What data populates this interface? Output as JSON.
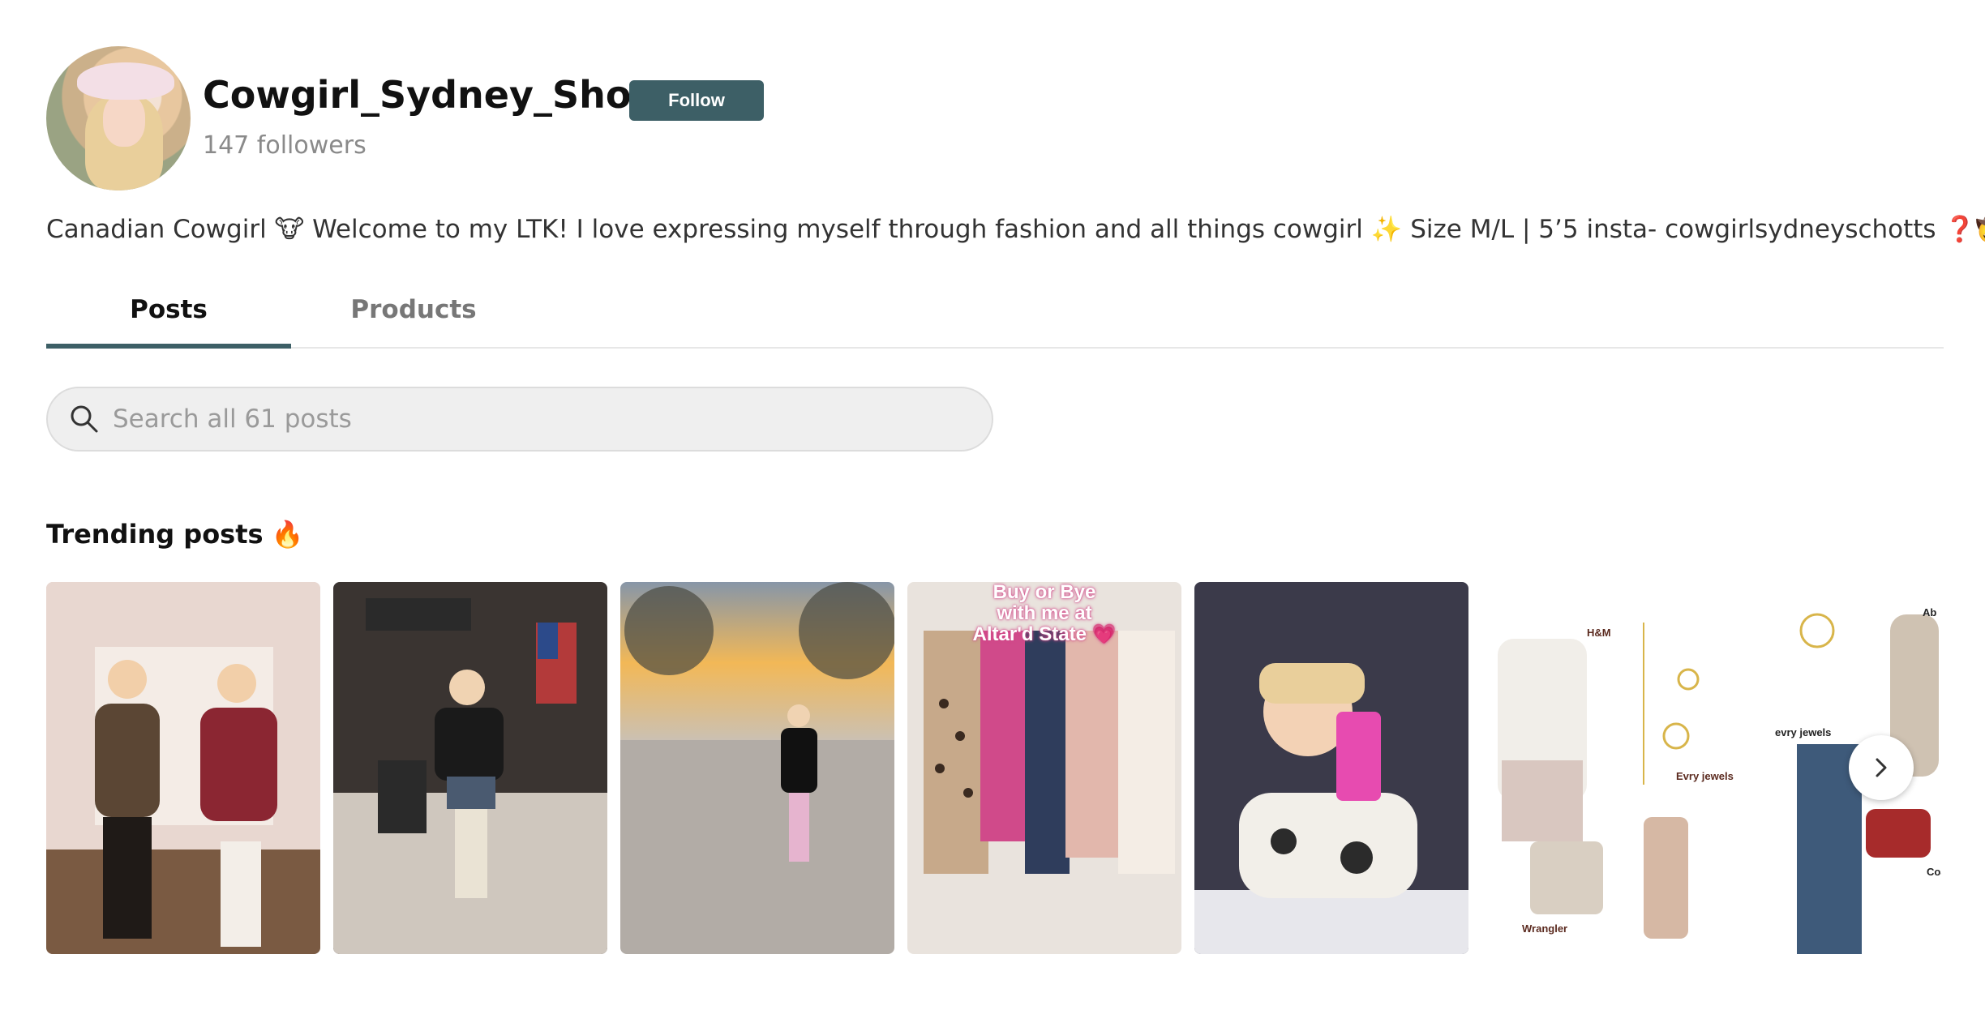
{
  "profile": {
    "name": "Cowgirl_Sydney_Shop",
    "follow_label": "Follow",
    "followers": "147 followers",
    "bio": "Canadian Cowgirl 🐮 Welcome to my LTK! I love expressing myself through fashion and all things cowgirl ✨ Size M/L | 5’5 insta- cowgirlsydneyschotts ❓🤠",
    "avatar_icon": "profile-photo"
  },
  "tabs": [
    {
      "label": "Posts",
      "active": true
    },
    {
      "label": "Products",
      "active": false
    }
  ],
  "search": {
    "placeholder": "Search all 61 posts",
    "value": ""
  },
  "trending": {
    "title": "Trending posts",
    "title_icon": "🔥",
    "next_icon": "chevron-right-icon",
    "posts": [
      {
        "overlay": ""
      },
      {
        "overlay": ""
      },
      {
        "overlay": ""
      },
      {
        "overlay": "Buy or Bye\nwith me at\nAltar'd State 💗"
      },
      {
        "overlay": ""
      },
      {
        "labels": [
          "H&M",
          "Evry jewels",
          "Wrangler"
        ]
      },
      {
        "labels": [
          "evry jewels",
          "Ab",
          "Coach"
        ]
      }
    ]
  },
  "colors": {
    "accent": "#3d5f66",
    "tab_border": "#e7e7e7",
    "search_bg": "#efefef"
  }
}
